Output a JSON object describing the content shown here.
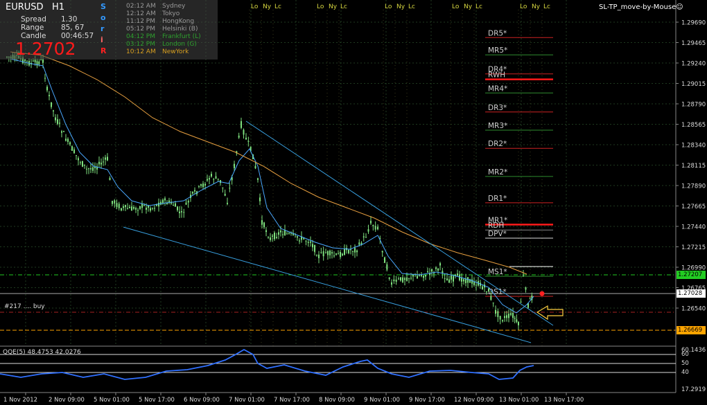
{
  "header": {
    "symbol": "EURUSD",
    "timeframe": "H1",
    "spread_label": "Spread",
    "spread_value": "1.30",
    "range_label": "Range",
    "range_value": "85, 67",
    "candle_label": "Candle",
    "candle_value": "00:46:57",
    "price": "1.2702",
    "session_letters": [
      "S",
      "o",
      "r",
      "i",
      "R"
    ],
    "session_letter_colors": [
      "#3399ff",
      "#3399ff",
      "#3399ff",
      "#ff6666",
      "#ff2020"
    ]
  },
  "timezones": [
    {
      "time": "02:12 AM",
      "city": "Sydney",
      "color": "#9a9a9a"
    },
    {
      "time": "12:12 AM",
      "city": "Tokyo",
      "color": "#9a9a9a"
    },
    {
      "time": "11:12 PM",
      "city": "HongKong",
      "color": "#9a9a9a"
    },
    {
      "time": "05:12 PM",
      "city": "Helsinki (B)",
      "color": "#9a9a9a"
    },
    {
      "time": "04:12 PM",
      "city": "Frankfurt (L)",
      "color": "#2ea02e"
    },
    {
      "time": "03:12 PM",
      "city": "London (G)",
      "color": "#2ea02e"
    },
    {
      "time": "10:12 AM",
      "city": "NewYork",
      "color": "#d8a020"
    }
  ],
  "ea_label": "SL-TP_move-by-Mouse☺",
  "session_marker_labels": [
    "Lo",
    "Ny",
    "Lc"
  ],
  "price_axis": {
    "labels": [
      "1.29690",
      "1.29465",
      "1.29240",
      "1.29015",
      "1.28790",
      "1.28565",
      "1.28340",
      "1.28115",
      "1.27890",
      "1.27665",
      "1.27440",
      "1.27215",
      "1.26990",
      "1.26765",
      "1.26540"
    ],
    "current_price": "1.27028",
    "green_level": "1.27207",
    "orange_level": "1.26669",
    "current_box_color": "#ffffff",
    "green_box_color": "#22cc22",
    "orange_box_color": "#ffa500"
  },
  "time_axis": [
    "1 Nov 2012",
    "2 Nov 09:00",
    "5 Nov 01:00",
    "5 Nov 17:00",
    "6 Nov 09:00",
    "7 Nov 01:00",
    "7 Nov 17:00",
    "8 Nov 09:00",
    "9 Nov 01:00",
    "9 Nov 17:00",
    "12 Nov 09:00",
    "13 Nov 01:00",
    "13 Nov 17:00"
  ],
  "pivot_levels": [
    {
      "label": "DR5*",
      "price": 1.2952,
      "color": "#cc2222"
    },
    {
      "label": "MR5*",
      "price": 1.2933,
      "color": "#2e8b2e"
    },
    {
      "label": "DR4*",
      "price": 1.2912,
      "color": "#cc2222"
    },
    {
      "label": "RWH",
      "price": 1.2906,
      "color": "#ff1a1a"
    },
    {
      "label": "MR4*",
      "price": 1.2891,
      "color": "#2e8b2e"
    },
    {
      "label": "DR3*",
      "price": 1.287,
      "color": "#cc2222"
    },
    {
      "label": "MR3*",
      "price": 1.285,
      "color": "#2e8b2e"
    },
    {
      "label": "DR2*",
      "price": 1.283,
      "color": "#cc2222"
    },
    {
      "label": "MR2*",
      "price": 1.2799,
      "color": "#2e8b2e"
    },
    {
      "label": "DR1*",
      "price": 1.277,
      "color": "#cc2222"
    },
    {
      "label": "MR1*",
      "price": 1.2746,
      "color": "#ff1a1a"
    },
    {
      "label": "RDH",
      "price": 1.274,
      "color": "#888888"
    },
    {
      "label": "DPV*",
      "price": 1.2731,
      "color": "#dddddd"
    },
    {
      "label": "MS1*",
      "price": 1.2689,
      "color": "#2e8b2e"
    },
    {
      "label": "DS1*",
      "price": 1.2667,
      "color": "#cc2222"
    }
  ],
  "trade_label": "#217 .... buy",
  "indicator": {
    "label": "QQE(5) 48.4753 42.0276",
    "axis_labels": [
      "60.1436",
      "60",
      "50",
      "40",
      "17.2919"
    ]
  },
  "colors": {
    "background": "#000000",
    "candle": "#7ee07e",
    "ma_fast": "#4aa8ff",
    "ma_slow": "#e8a040",
    "channel": "#38a0e0",
    "grid": "#1f3a1f",
    "qqe": "#3070ff"
  }
}
